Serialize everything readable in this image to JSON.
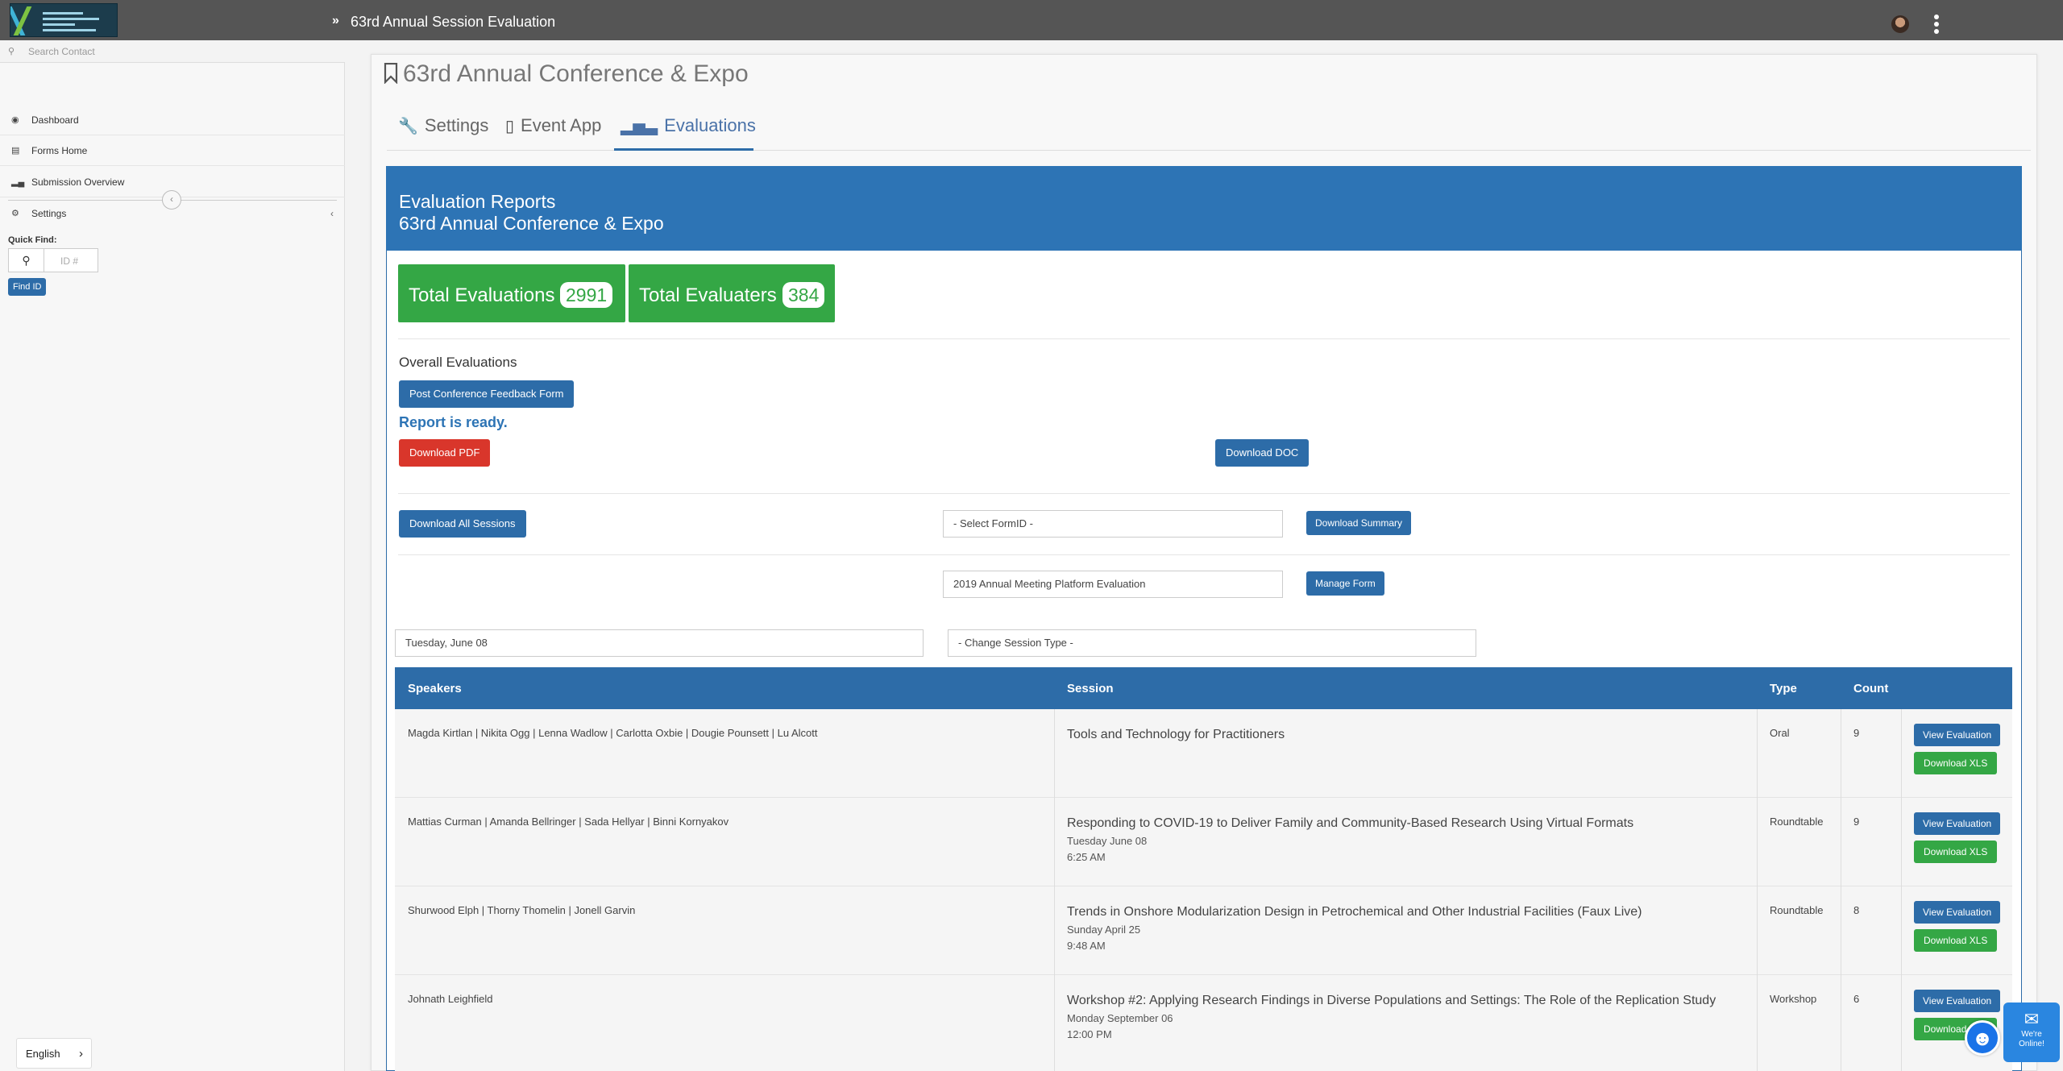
{
  "topbar": {
    "title": "63rd Annual Session Evaluation"
  },
  "sidebar": {
    "search_placeholder": "Search Contact",
    "items": [
      {
        "label": "Dashboard",
        "icon": "dashboard-icon"
      },
      {
        "label": "Forms Home",
        "icon": "forms-icon"
      },
      {
        "label": "Submission Overview",
        "icon": "bar-chart-icon"
      },
      {
        "label": "Settings",
        "icon": "gears-icon"
      }
    ],
    "quick_find_label": "Quick Find:",
    "id_placeholder": "ID #",
    "find_button": "Find ID",
    "language": "English"
  },
  "main": {
    "title": "63rd Annual Conference & Expo",
    "tabs": [
      {
        "label": "Settings",
        "icon": "wrench-icon"
      },
      {
        "label": "Event App",
        "icon": "mobile-icon"
      },
      {
        "label": "Evaluations",
        "icon": "bar-chart-icon",
        "active": true
      }
    ],
    "panel_title_1": "Evaluation Reports",
    "panel_title_2": "63rd Annual Conference & Expo",
    "stats": {
      "total_evaluations_label": "Total Evaluations",
      "total_evaluations": "2991",
      "total_evaluaters_label": "Total Evaluaters",
      "total_evaluaters": "384"
    },
    "overall_label": "Overall Evaluations",
    "feedback_form_button": "Post Conference Feedback Form",
    "report_ready": "Report is ready.",
    "download_pdf": "Download PDF",
    "download_doc": "Download DOC",
    "download_all_sessions": "Download All Sessions",
    "select_formid": "- Select FormID -",
    "download_summary": "Download Summary",
    "form_name": "2019 Annual Meeting Platform Evaluation",
    "manage_form": "Manage Form",
    "date_select": "Tuesday, June 08",
    "session_type_select": "- Change Session Type -",
    "table": {
      "headers": [
        "Speakers",
        "Session",
        "Type",
        "Count"
      ],
      "view_label": "View Evaluation",
      "xls_label": "Download XLS",
      "rows": [
        {
          "speakers": "Magda Kirtlan | Nikita Ogg | Lenna Wadlow | Carlotta Oxbie | Dougie Pounsett | Lu Alcott",
          "session": "Tools and Technology for Practitioners",
          "date": "",
          "time": "",
          "type": "Oral",
          "count": "9"
        },
        {
          "speakers": "Mattias Curman | Amanda Bellringer | Sada Hellyar | Binni Kornyakov",
          "session": "Responding to COVID-19 to Deliver Family and Community-Based Research Using Virtual Formats",
          "date": "Tuesday June 08",
          "time": "6:25 AM",
          "type": "Roundtable",
          "count": "9"
        },
        {
          "speakers": "Shurwood Elph | Thorny Thomelin | Jonell Garvin",
          "session": "Trends in Onshore Modularization Design in Petrochemical and Other Industrial Facilities (Faux Live)",
          "date": "Sunday April 25",
          "time": "9:48 AM",
          "type": "Roundtable",
          "count": "8"
        },
        {
          "speakers": "Johnath Leighfield",
          "session": "Workshop #2: Applying Research Findings in Diverse Populations and Settings: The Role of the Replication Study",
          "date": "Monday September 06",
          "time": "12:00 PM",
          "type": "Workshop",
          "count": "6"
        }
      ]
    }
  },
  "chat_widget": {
    "line1": "We're",
    "line2": "Online!"
  },
  "colors": {
    "primary": "#2d6ca8",
    "success": "#34a745",
    "danger": "#d9362b",
    "topbar": "#555555"
  }
}
